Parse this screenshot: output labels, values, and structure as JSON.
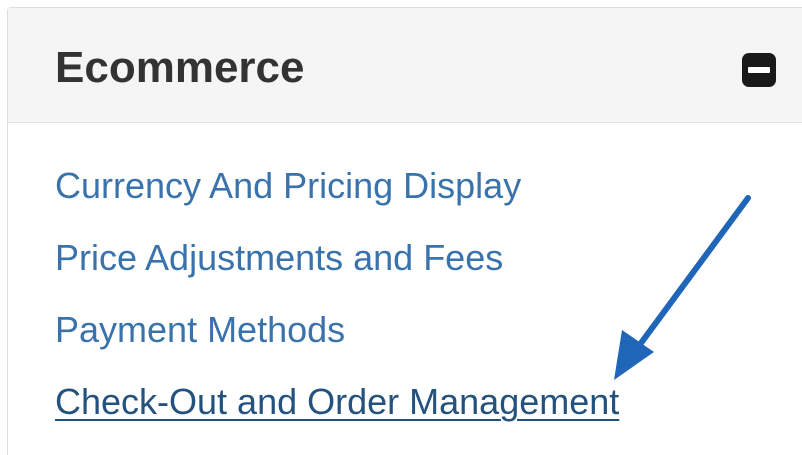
{
  "panel": {
    "title": "Ecommerce",
    "collapse_icon": "minus-square-icon",
    "links": [
      {
        "label": "Currency And Pricing Display",
        "active": false
      },
      {
        "label": "Price Adjustments and Fees",
        "active": false
      },
      {
        "label": "Payment Methods",
        "active": false
      },
      {
        "label": "Check-Out and Order Management",
        "active": true
      }
    ]
  },
  "annotation": {
    "icon": "arrow-icon",
    "color": "#1f66b8"
  },
  "colors": {
    "link": "#3a72ac",
    "link_active": "#24527f",
    "header_bg": "#f5f5f5",
    "title": "#333333"
  }
}
